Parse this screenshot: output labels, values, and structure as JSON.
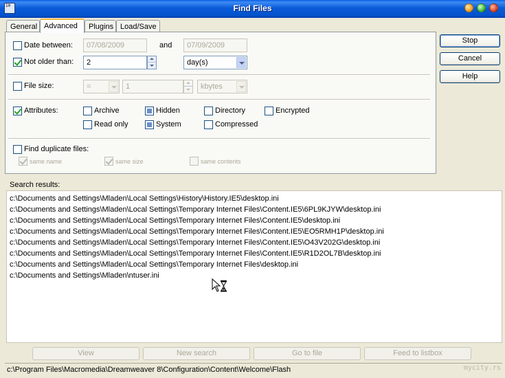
{
  "window": {
    "title": "Find Files",
    "icon": "app-icon",
    "icon_text": "10"
  },
  "tabs": [
    {
      "label": "General",
      "active": false
    },
    {
      "label": "Advanced",
      "active": true
    },
    {
      "label": "Plugins",
      "active": false
    },
    {
      "label": "Load/Save",
      "active": false
    }
  ],
  "date_between": {
    "label": "Date between:",
    "checked": false,
    "from": "07/08/2009",
    "and_label": "and",
    "to": "07/09/2009"
  },
  "not_older_than": {
    "label": "Not older than:",
    "checked": true,
    "value": "2",
    "unit": "day(s)"
  },
  "file_size": {
    "label": "File size:",
    "checked": false,
    "operator": "=",
    "value": "1",
    "unit": "kbytes"
  },
  "attributes": {
    "label": "Attributes:",
    "checked": true,
    "items": {
      "archive": "Archive",
      "hidden": "Hidden",
      "directory": "Directory",
      "encrypted": "Encrypted",
      "read_only": "Read only",
      "system": "System",
      "compressed": "Compressed"
    }
  },
  "duplicates": {
    "label": "Find duplicate files:",
    "checked": false,
    "same_name": "same name",
    "same_size": "same size",
    "same_contents": "same contents"
  },
  "side_buttons": {
    "stop": "Stop",
    "cancel": "Cancel",
    "help": "Help"
  },
  "results": {
    "label": "Search results:",
    "items": [
      "c:\\Documents and Settings\\Mladen\\Local Settings\\History\\History.IE5\\desktop.ini",
      "c:\\Documents and Settings\\Mladen\\Local Settings\\Temporary Internet Files\\Content.IE5\\6PL9KJYW\\desktop.ini",
      "c:\\Documents and Settings\\Mladen\\Local Settings\\Temporary Internet Files\\Content.IE5\\desktop.ini",
      "c:\\Documents and Settings\\Mladen\\Local Settings\\Temporary Internet Files\\Content.IE5\\EO5RMH1P\\desktop.ini",
      "c:\\Documents and Settings\\Mladen\\Local Settings\\Temporary Internet Files\\Content.IE5\\O43V202G\\desktop.ini",
      "c:\\Documents and Settings\\Mladen\\Local Settings\\Temporary Internet Files\\Content.IE5\\R1D2OL7B\\desktop.ini",
      "c:\\Documents and Settings\\Mladen\\Local Settings\\Temporary Internet Files\\desktop.ini",
      "c:\\Documents and Settings\\Mladen\\ntuser.ini"
    ]
  },
  "bottom_buttons": {
    "view": "View",
    "new_search": "New search",
    "goto_file": "Go to file",
    "feed": "Feed to listbox"
  },
  "status": "c:\\Program Files\\Macromedia\\Dreamweaver 8\\Configuration\\Content\\Welcome\\Flash",
  "watermark": "mycity.rs"
}
